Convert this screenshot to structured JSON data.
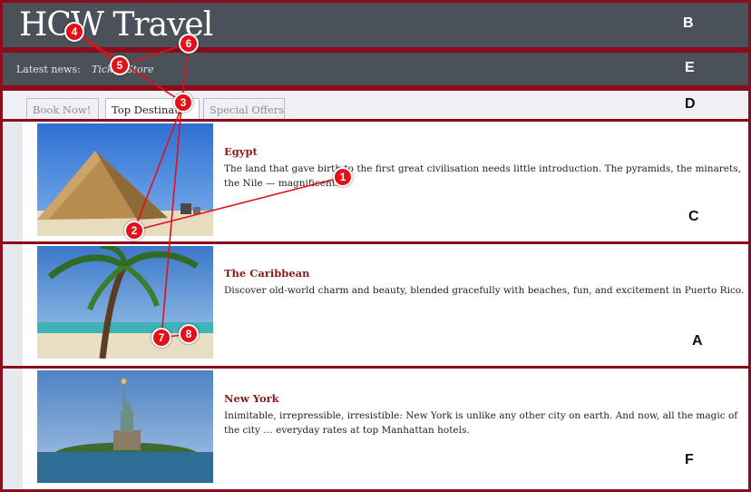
{
  "header": {
    "title": "HCW Travel",
    "region_label": "B"
  },
  "news": {
    "label": "Latest news:",
    "text": "Ticket Store",
    "region_label": "E"
  },
  "tabs": {
    "region_label": "D",
    "items": [
      {
        "label": "Book Now!",
        "active": false
      },
      {
        "label": "Top Destinati",
        "active": true
      },
      {
        "label": "Special Offers",
        "active": false
      }
    ]
  },
  "destinations": [
    {
      "title": "Egypt",
      "description": "The land that gave birth to the first great civilisation needs little introduction. The pyramids, the minarets, the Nile — magnificent.",
      "region_label": "C",
      "image": "pyramid-photo"
    },
    {
      "title": "The Caribbean",
      "description": "Discover old-world charm and beauty, blended gracefully with beaches, fun, and excitement in Puerto Rico.",
      "region_label": "A",
      "image": "palm-beach-photo"
    },
    {
      "title": "New York",
      "description": "Inimitable, irrepressible, irresistible: New York is unlike any other city on earth. And now, all the magic of the city … everyday rates at top Manhattan hotels.",
      "region_label": "F",
      "image": "statue-of-liberty-photo"
    }
  ],
  "gaze_markers": [
    "1",
    "2",
    "3",
    "4",
    "5",
    "6",
    "7",
    "8"
  ],
  "colors": {
    "header_bg": "#4a5159",
    "region_border": "#8b0c1a",
    "marker": "#e3101a",
    "destination_title": "#8b1a1a"
  }
}
